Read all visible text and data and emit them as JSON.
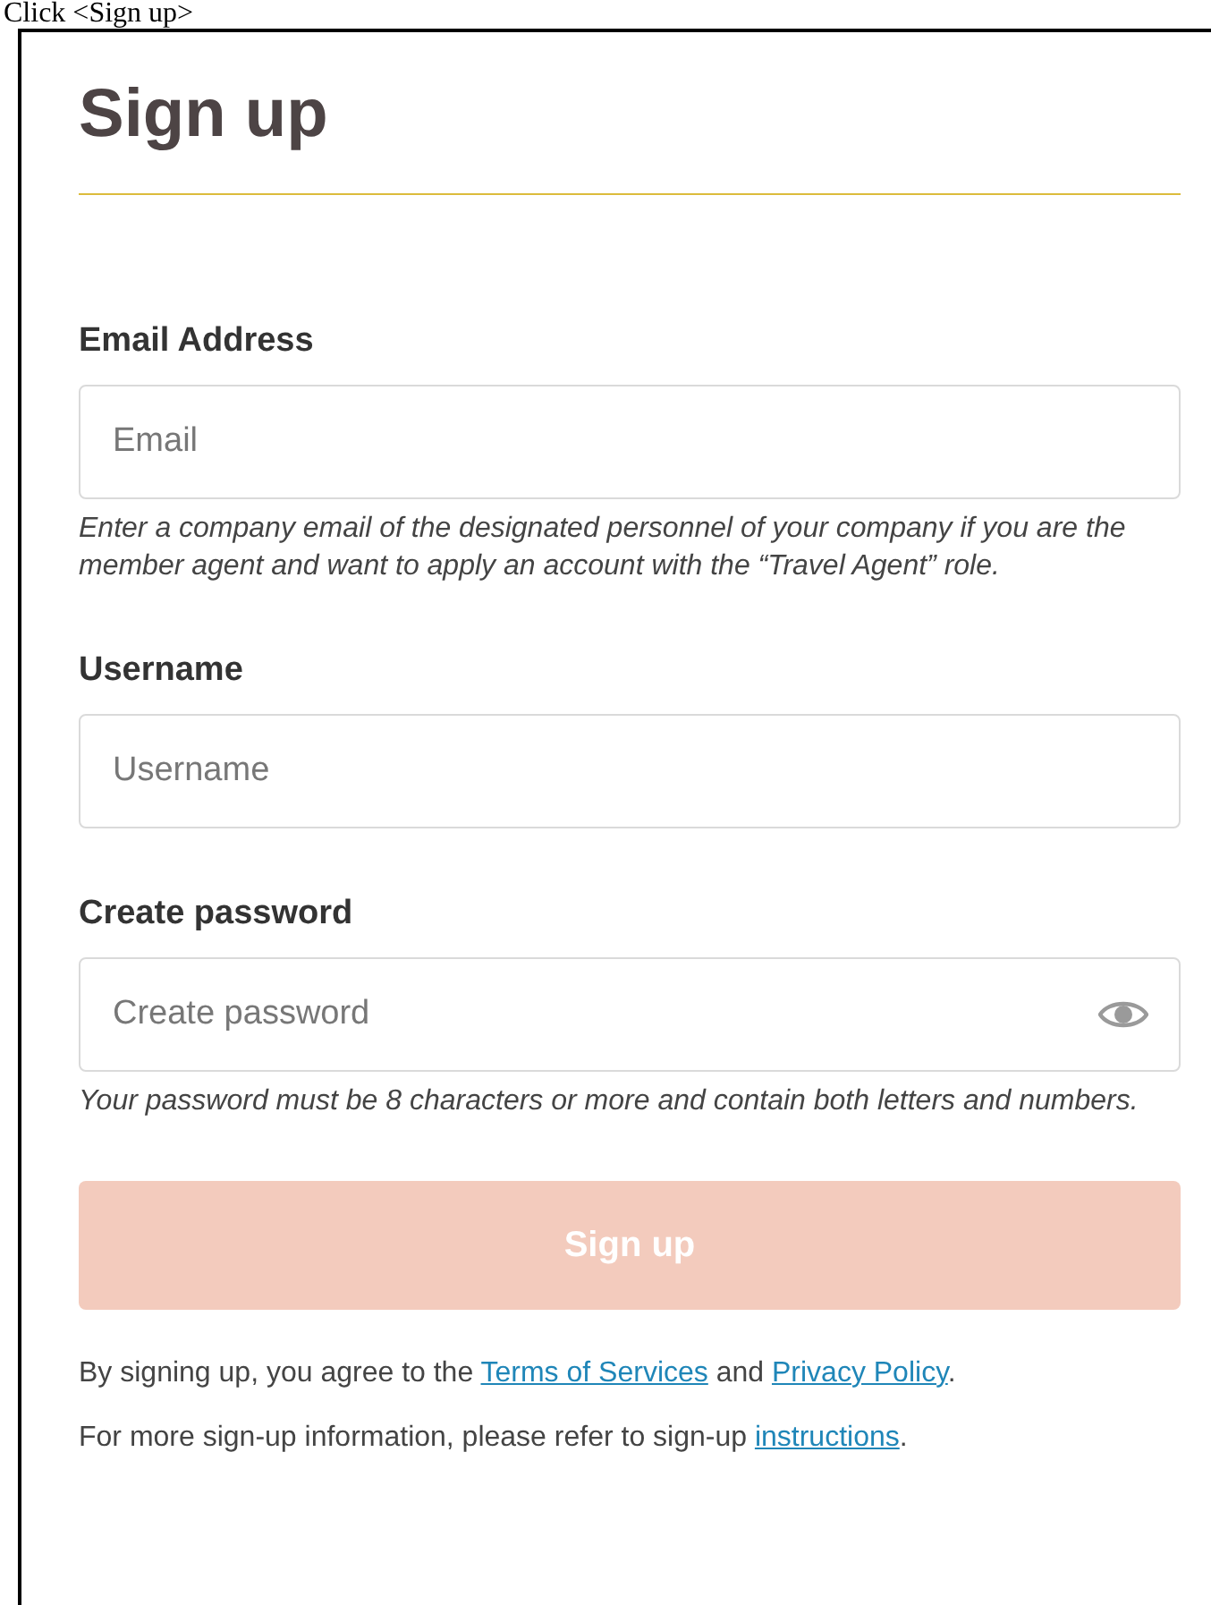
{
  "caption": "Click <Sign up>",
  "title": "Sign up",
  "fields": [
    {
      "kind": "text",
      "label": "Email Address",
      "placeholder": "Email",
      "hint": "Enter a company email of the designated personnel of your company if you are the member agent and want to apply an account with the “Travel Agent” role."
    },
    {
      "kind": "text",
      "label": "Username",
      "placeholder": "Username"
    },
    {
      "kind": "password",
      "label": "Create password",
      "placeholder": "Create password",
      "hint": "Your password must be 8 characters or more and contain both letters and numbers."
    }
  ],
  "submit": {
    "label": "Sign up",
    "disabled": true
  },
  "notes": [
    {
      "segments": [
        {
          "kind": "text",
          "text": "By signing up, you agree to the "
        },
        {
          "kind": "link",
          "text": "Terms of Services"
        },
        {
          "kind": "text",
          "text": " and "
        },
        {
          "kind": "link",
          "text": "Privacy Policy"
        },
        {
          "kind": "text",
          "text": "."
        }
      ]
    },
    {
      "segments": [
        {
          "kind": "text",
          "text": "For more sign-up information, please refer to sign-up "
        },
        {
          "kind": "link",
          "text": "instructions"
        },
        {
          "kind": "text",
          "text": "."
        }
      ]
    }
  ]
}
